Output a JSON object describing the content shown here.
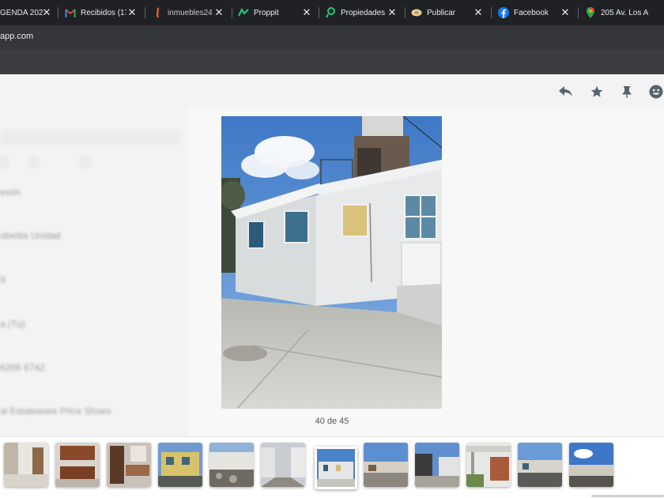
{
  "browser": {
    "tabs": [
      {
        "title": "GENDA 202",
        "icon": "calendar-icon"
      },
      {
        "title": "Recibidos (17",
        "icon": "gmail-icon"
      },
      {
        "title": "inmuebles24",
        "icon": "inmuebles24-icon"
      },
      {
        "title": "Proppit",
        "icon": "proppit-icon"
      },
      {
        "title": "Propiedades",
        "icon": "propiedades-icon"
      },
      {
        "title": "Publicar",
        "icon": "publicar-icon"
      },
      {
        "title": "Facebook",
        "icon": "facebook-icon"
      },
      {
        "title": "205 Av. Los A",
        "icon": "maps-pin-icon"
      }
    ],
    "url": "app.com"
  },
  "background_chat_list": {
    "chips": [
      "",
      "",
      ""
    ],
    "rows": [
      {
        "name": "esón",
        "time": "",
        "message": ""
      },
      {
        "name": "obelita Unidad",
        "time": "",
        "message": ""
      },
      {
        "name": "9",
        "time": "",
        "message": ""
      },
      {
        "name": "a (Tú)",
        "time": "",
        "message": ""
      },
      {
        "name": "6206 6742",
        "time": "",
        "message": ""
      },
      {
        "name": "al Estateware Price Shoes",
        "time": "",
        "message": ""
      }
    ]
  },
  "viewer": {
    "actions": [
      "reply-icon",
      "star-icon",
      "pin-icon",
      "emoji-icon"
    ],
    "counter": "40 de 45",
    "thumbnails": [
      {
        "scene": "interior-room"
      },
      {
        "scene": "kitchen"
      },
      {
        "scene": "dining-room"
      },
      {
        "scene": "yellow-house"
      },
      {
        "scene": "stone-wall"
      },
      {
        "scene": "alley"
      },
      {
        "scene": "white-house-selected"
      },
      {
        "scene": "street-houses"
      },
      {
        "scene": "street"
      },
      {
        "scene": "carport"
      },
      {
        "scene": "rooftop-view"
      },
      {
        "scene": "sky-street"
      }
    ],
    "selected_index": 6
  },
  "colors": {
    "tabbar_bg": "#202124",
    "address_bg": "#35363a",
    "bookmark_bg": "#3c3d40",
    "viewer_bg": "#f8f8f8",
    "icon": "#54656f"
  }
}
